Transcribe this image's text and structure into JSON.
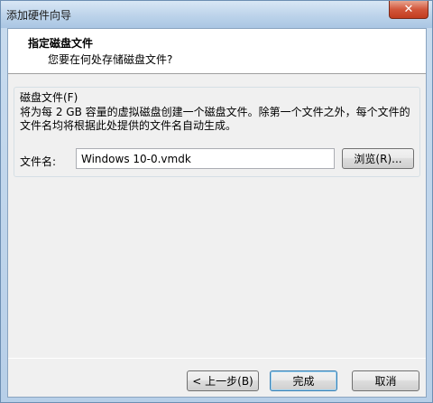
{
  "window": {
    "title": "添加硬件向导",
    "close_label": "✕"
  },
  "header": {
    "title": "指定磁盘文件",
    "subtitle": "您要在何处存储磁盘文件?"
  },
  "disk_file": {
    "group_label": "磁盘文件(F)",
    "description": "将为每 2 GB 容量的虚拟磁盘创建一个磁盘文件。除第一个文件之外，每个文件的文件名均将根据此处提供的文件名自动生成。",
    "filename_label": "文件名:",
    "filename_value": "Windows 10-0.vmdk",
    "browse_label": "浏览(R)..."
  },
  "footer": {
    "back_label": "< 上一步(B)",
    "finish_label": "完成",
    "cancel_label": "取消"
  }
}
